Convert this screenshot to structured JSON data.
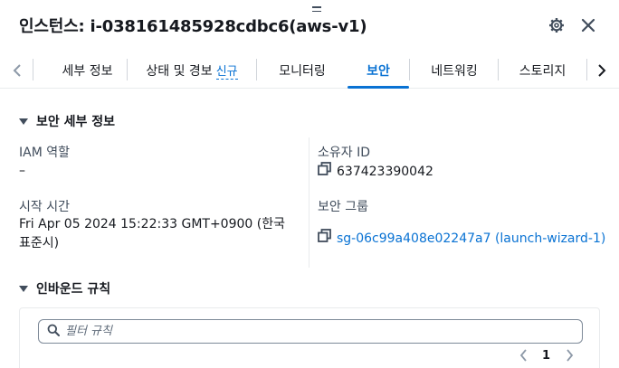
{
  "header": {
    "title": "인스턴스: i-038161485928cdbc6(aws-v1)"
  },
  "tabs": [
    {
      "label": "세부 정보"
    },
    {
      "label": "상태 및 경보",
      "badge": "신규"
    },
    {
      "label": "모니터링"
    },
    {
      "label": "보안",
      "active": true
    },
    {
      "label": "네트워킹"
    },
    {
      "label": "스토리지"
    }
  ],
  "security_details": {
    "title": "보안 세부 정보",
    "iam_role_label": "IAM 역할",
    "iam_role_value": "–",
    "owner_id_label": "소유자 ID",
    "owner_id_value": "637423390042",
    "launch_time_label": "시작 시간",
    "launch_time_value": "Fri Apr 05 2024 15:22:33 GMT+0900 (한국 표준시)",
    "security_groups_label": "보안 그룹",
    "security_group_link": "sg-06c99a408e02247a7 (launch-wizard-1)"
  },
  "inbound_rules": {
    "title": "인바운드 규칙",
    "filter_placeholder": "필터 규칙",
    "current_page": "1"
  },
  "colors": {
    "accent": "#0972d3",
    "text": "#16191f",
    "label": "#414d5c",
    "divider": "#e9ebed"
  },
  "icons": [
    "settings-gear-icon",
    "close-icon",
    "chevron-left-icon",
    "chevron-right-icon",
    "caret-down-icon",
    "copy-icon",
    "search-icon"
  ]
}
